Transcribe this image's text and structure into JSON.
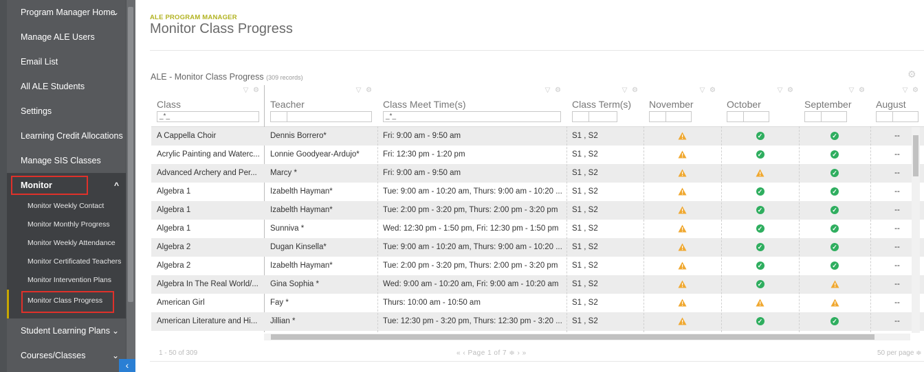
{
  "sidebar": {
    "items": [
      {
        "label": "Program Manager Home",
        "chevron": "⌄"
      },
      {
        "label": "Manage ALE Users"
      },
      {
        "label": "Email List"
      },
      {
        "label": "All ALE Students"
      },
      {
        "label": "Settings"
      },
      {
        "label": "Learning Credit Allocations"
      },
      {
        "label": "Manage SIS Classes"
      },
      {
        "label": "Monitor",
        "chevron": "^"
      }
    ],
    "monitor_subitems": [
      "Monitor Weekly Contact",
      "Monitor Monthly Progress",
      "Monitor Weekly Attendance",
      "Monitor Certificated Teachers",
      "Monitor Intervention Plans",
      "Monitor Class Progress"
    ],
    "bottom_items": [
      {
        "label": "Student Learning Plans",
        "chevron": "⌄"
      },
      {
        "label": "Courses/Classes",
        "chevron": "⌄"
      }
    ],
    "collapse_glyph": "‹"
  },
  "header": {
    "kicker": "ALE PROGRAM MANAGER",
    "title": "Monitor Class Progress"
  },
  "grid": {
    "caption": "ALE - Monitor Class Progress",
    "record_count": "(309 records)",
    "columns": [
      "Class",
      "Teacher",
      "Class Meet Time(s)",
      "Class Term(s)",
      "November",
      "October",
      "September",
      "August"
    ],
    "filter_placeholder": "_*_",
    "rows": [
      {
        "class": "A Cappella Choir",
        "teacher": "Dennis Borrero*",
        "meet": "Fri: 9:00 am - 9:50 am",
        "term": "S1 , S2",
        "nov": "warn",
        "oct": "ok",
        "sep": "ok",
        "aug": "--"
      },
      {
        "class": "Acrylic Painting and Waterc...",
        "teacher": "Lonnie Goodyear-Ardujo*",
        "meet": "Fri: 12:30 pm - 1:20 pm",
        "term": "S1 , S2",
        "nov": "warn",
        "oct": "ok",
        "sep": "ok",
        "aug": "--"
      },
      {
        "class": "Advanced Archery and Per...",
        "teacher": "Marcy *",
        "meet": "Fri: 9:00 am - 9:50 am",
        "term": "S1 , S2",
        "nov": "warn",
        "oct": "warn",
        "sep": "ok",
        "aug": "--"
      },
      {
        "class": "Algebra 1",
        "teacher": "Izabelth Hayman*",
        "meet": "Tue: 9:00 am - 10:20 am, Thurs: 9:00 am - 10:20 ...",
        "term": "S1 , S2",
        "nov": "warn",
        "oct": "ok",
        "sep": "ok",
        "aug": "--"
      },
      {
        "class": "Algebra 1",
        "teacher": "Izabelth Hayman*",
        "meet": "Tue: 2:00 pm - 3:20 pm, Thurs: 2:00 pm - 3:20 pm",
        "term": "S1 , S2",
        "nov": "warn",
        "oct": "ok",
        "sep": "ok",
        "aug": "--"
      },
      {
        "class": "Algebra 1",
        "teacher": "Sunniva *",
        "meet": "Wed: 12:30 pm - 1:50 pm, Fri: 12:30 pm - 1:50 pm",
        "term": "S1 , S2",
        "nov": "warn",
        "oct": "ok",
        "sep": "ok",
        "aug": "--"
      },
      {
        "class": "Algebra 2",
        "teacher": "Dugan Kinsella*",
        "meet": "Tue: 9:00 am - 10:20 am, Thurs: 9:00 am - 10:20 ...",
        "term": "S1 , S2",
        "nov": "warn",
        "oct": "ok",
        "sep": "ok",
        "aug": "--"
      },
      {
        "class": "Algebra 2",
        "teacher": "Izabelth Hayman*",
        "meet": "Tue: 2:00 pm - 3:20 pm, Thurs: 2:00 pm - 3:20 pm",
        "term": "S1 , S2",
        "nov": "warn",
        "oct": "ok",
        "sep": "ok",
        "aug": "--"
      },
      {
        "class": "Algebra In The Real World/...",
        "teacher": "Gina Sophia *",
        "meet": "Wed: 9:00 am - 10:20 am, Fri: 9:00 am - 10:20 am",
        "term": "S1 , S2",
        "nov": "warn",
        "oct": "ok",
        "sep": "warn",
        "aug": "--"
      },
      {
        "class": "American Girl",
        "teacher": "Fay *",
        "meet": "Thurs: 10:00 am - 10:50 am",
        "term": "S1 , S2",
        "nov": "warn",
        "oct": "warn",
        "sep": "warn",
        "aug": "--"
      },
      {
        "class": "American Literature and Hi...",
        "teacher": "Jillian *",
        "meet": "Tue: 12:30 pm - 3:20 pm, Thurs: 12:30 pm - 3:20 ...",
        "term": "S1 , S2",
        "nov": "warn",
        "oct": "ok",
        "sep": "ok",
        "aug": "--"
      }
    ]
  },
  "footer": {
    "range": "1 - 50 of 309",
    "pager": "«   ‹   Page 1 of 7 ≑   ›   »",
    "per_page": "50 per page ≑"
  },
  "colors": {
    "warn": "#f0a830",
    "ok": "#2fae5f",
    "accent": "#b2b321",
    "highlight": "#e0312a"
  }
}
